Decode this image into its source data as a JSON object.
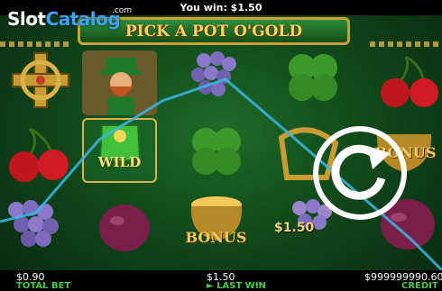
{
  "header": {
    "win_message": "You win: $1.50"
  },
  "branding": {
    "logo_white": "Slot",
    "logo_blue": "Catalog",
    "logo_com": ".com"
  },
  "game": {
    "title": "PICK A POT O'GOLD"
  },
  "reels": {
    "symbols": [
      [
        "celtic-cross",
        "cherries",
        "grapes",
        "plum"
      ],
      [
        "leprechaun",
        "wild-pot",
        "empty",
        "empty"
      ],
      [
        "grapes",
        "clover",
        "bonus-pot",
        "empty"
      ],
      [
        "clover",
        "harp",
        "grapes",
        "empty"
      ],
      [
        "cherries",
        "bonus-pot",
        "plum",
        "empty"
      ]
    ],
    "wild_label": "WILD",
    "bonus_label": "BONUS",
    "bonus_label_right": "BONUS",
    "cell_win": "$1.50"
  },
  "footer": {
    "total_bet_value": "$0.90",
    "total_bet_label": "TOTAL BET",
    "last_win_value": "$1.50",
    "last_win_label": "LAST WIN",
    "last_win_icon": "play-icon",
    "credit_value": "$999999990.60",
    "credit_label": "CREDIT"
  },
  "colors": {
    "gold": "#f2c75c",
    "green_label": "#48c84a",
    "payline": "#38b8e6"
  }
}
